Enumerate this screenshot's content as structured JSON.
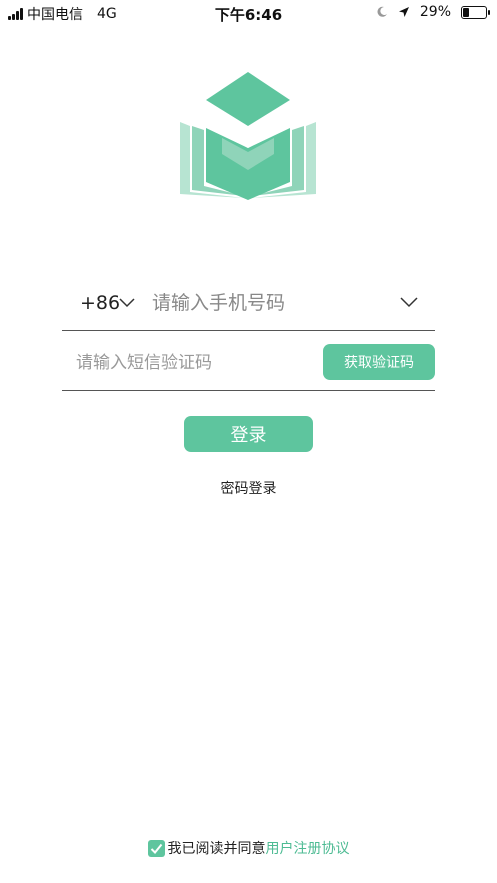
{
  "status_bar": {
    "carrier": "中国电信",
    "network": "4G",
    "time": "下午6:46",
    "battery": "29%",
    "battery_level": 0.29
  },
  "login": {
    "country_code": "+86",
    "phone_placeholder": "请输入手机号码",
    "code_placeholder": "请输入短信验证码",
    "get_code_label": "获取验证码",
    "login_label": "登录",
    "password_login_label": "密码登录"
  },
  "agreement": {
    "text": "我已阅读并同意",
    "link": "用户注册协议",
    "checked": true
  },
  "colors": {
    "accent": "#5ec59e",
    "logo_dark": "#5ec59e",
    "logo_light": "#b7e4d2"
  },
  "icons": {
    "logo": "graduation-book-logo",
    "country_chevron": "chevron-down-icon",
    "phone_chevron": "chevron-down-icon",
    "checkbox": "checkmark-icon",
    "location": "location-arrow-icon",
    "moon": "moon-icon"
  }
}
